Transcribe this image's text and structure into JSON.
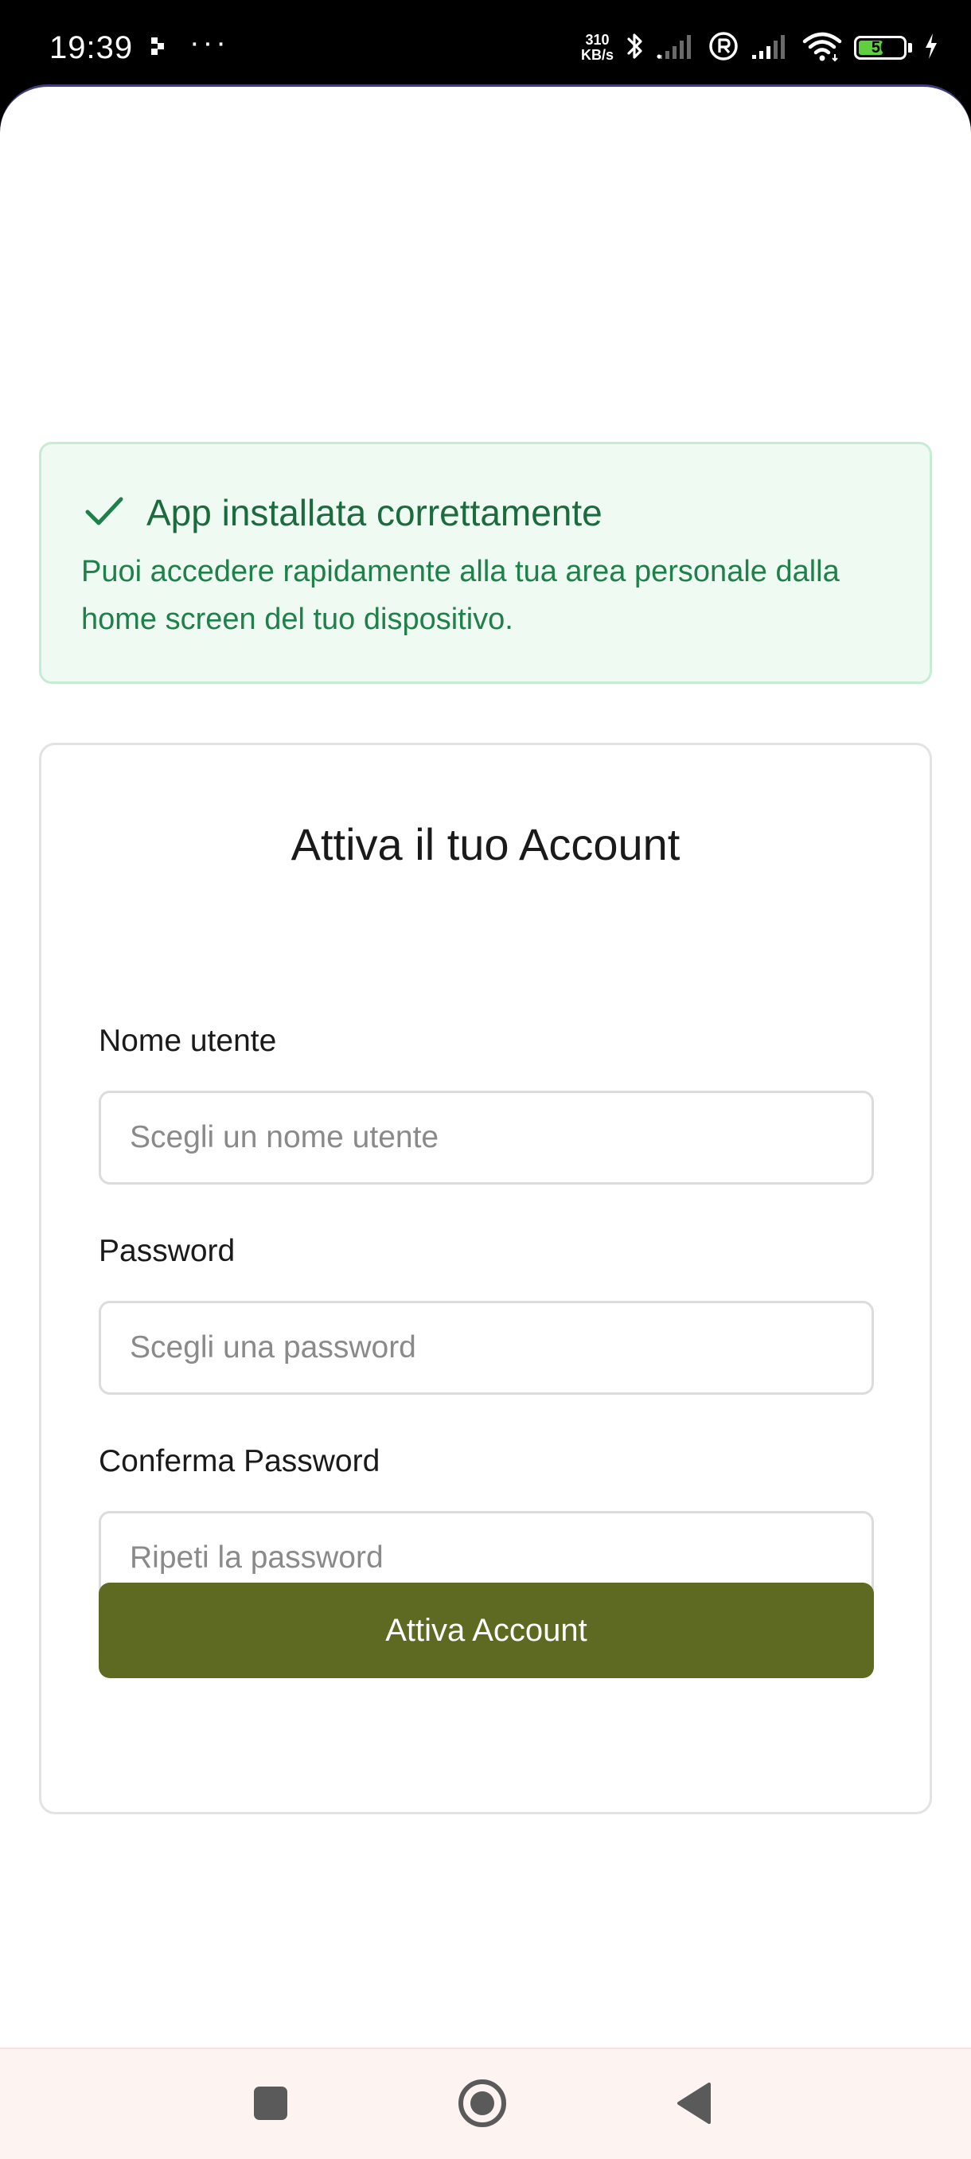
{
  "status_bar": {
    "time": "19:39",
    "dots": "···",
    "net_speed_value": "310",
    "net_speed_unit": "KB/s",
    "battery_level": "56"
  },
  "alert": {
    "title": "App installata correttamente",
    "message": "Puoi accedere rapidamente alla tua area personale dalla home screen del tuo dispositivo."
  },
  "form": {
    "title": "Attiva il tuo Account",
    "username_label": "Nome utente",
    "username_placeholder": "Scegli un nome utente",
    "password_label": "Password",
    "password_placeholder": "Scegli una password",
    "confirm_label": "Conferma Password",
    "confirm_placeholder": "Ripeti la password",
    "submit_label": "Attiva Account"
  },
  "colors": {
    "accent": "#5e6a22",
    "success_bg": "#effaf3",
    "success_border": "#c7ecd4",
    "success_text": "#1f8049"
  },
  "icons": {
    "alert": "check-icon",
    "nav": [
      "recent-apps-icon",
      "home-icon",
      "back-icon"
    ]
  }
}
